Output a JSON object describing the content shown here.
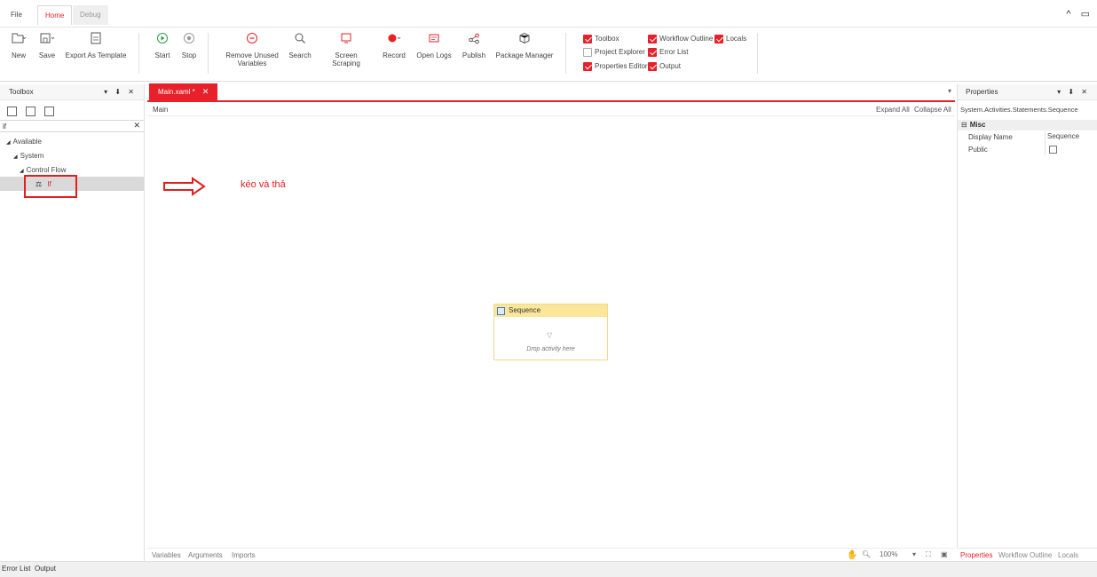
{
  "menu": {
    "file": "File",
    "home": "Home",
    "debug": "Debug"
  },
  "window": {
    "controls": "^ ▭"
  },
  "ribbon": {
    "new": "New",
    "save": "Save",
    "export_template": "Export As Template",
    "start": "Start",
    "stop": "Stop",
    "remove_unused_line1": "Remove Unused",
    "remove_unused_line2": "Variables",
    "search": "Search",
    "screen_scraping": "Screen Scraping",
    "record": "Record",
    "open_logs": "Open Logs",
    "publish": "Publish",
    "package_manager": "Package Manager",
    "checks": {
      "toolbox": "Toolbox",
      "workflow_outline": "Workflow Outline",
      "locals": "Locals",
      "project_explorer": "Project Explorer",
      "error_list": "Error List",
      "properties_editor": "Properties Editor",
      "output": "Output"
    }
  },
  "toolbox": {
    "title": "Toolbox",
    "header_controls": "▾ ⬇ ✕",
    "search_value": "if",
    "tree": {
      "available": "Available",
      "system": "System",
      "control_flow": "Control Flow",
      "if_item": "If"
    }
  },
  "designer": {
    "tab_label": "Main.xaml *",
    "breadcrumb": "Main",
    "expand_all": "Expand All",
    "collapse_all": "Collapse All",
    "annotation": "kéo và thả",
    "sequence_title": "Sequence",
    "drop_hint": "Drop activity here",
    "bottom_tabs": {
      "variables": "Variables",
      "arguments": "Arguments",
      "imports": "Imports"
    },
    "zoom": "100%"
  },
  "properties": {
    "title": "Properties",
    "header_controls": "▾ ⬇ ✕",
    "type_name": "System.Activities.Statements.Sequence",
    "category": "Misc",
    "display_name_label": "Display Name",
    "display_name_value": "Sequence",
    "public_label": "Public",
    "tabs": {
      "properties": "Properties",
      "workflow_outline": "Workflow Outline",
      "locals": "Locals"
    }
  },
  "statusbar": {
    "error_list": "Error List",
    "output": "Output"
  },
  "colors": {
    "accent": "#e8202a",
    "sequence_header": "#fbe79a"
  }
}
